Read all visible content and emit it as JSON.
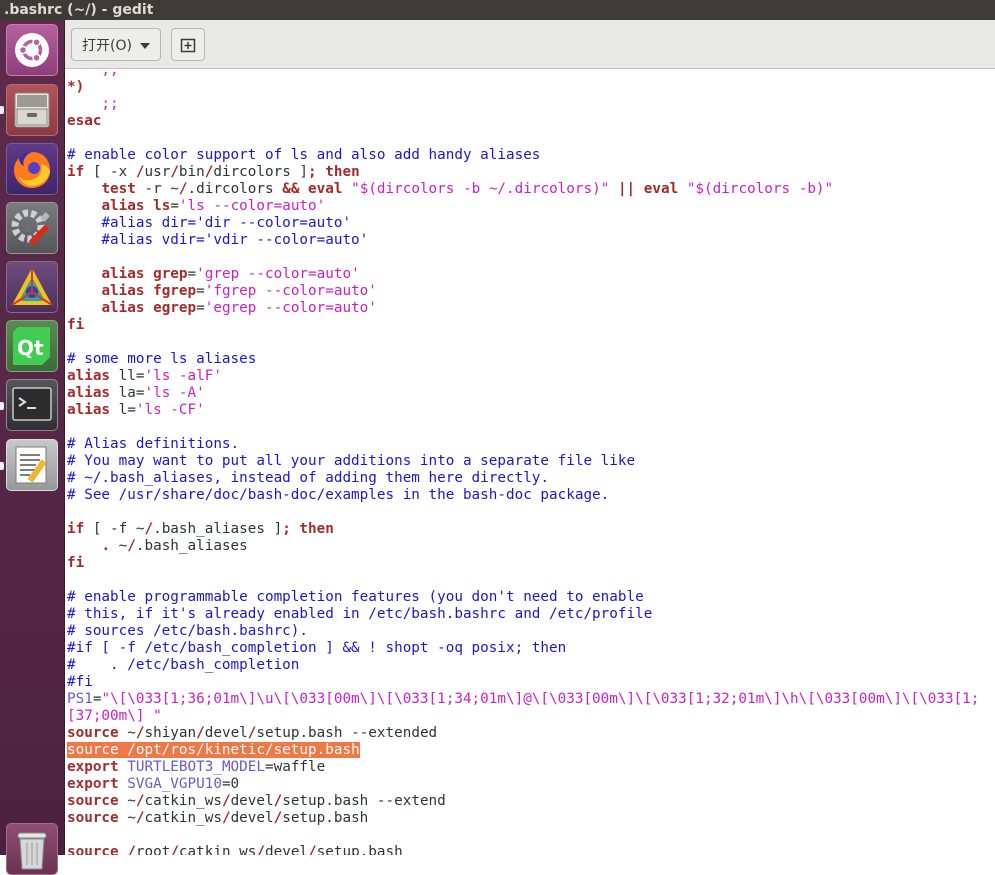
{
  "window": {
    "title": ".bashrc (~/) - gedit"
  },
  "toolbar": {
    "open_label": "打开(O)",
    "new_tab_icon": "new-tab-icon"
  },
  "launcher": [
    {
      "name": "ubuntu-dash-icon"
    },
    {
      "name": "files-icon"
    },
    {
      "name": "firefox-icon"
    },
    {
      "name": "system-settings-icon"
    },
    {
      "name": "rviz-icon"
    },
    {
      "name": "qt-creator-icon"
    },
    {
      "name": "terminal-icon"
    },
    {
      "name": "text-editor-icon"
    },
    {
      "name": "trash-icon"
    }
  ],
  "colors": {
    "keyword": "#a52a2a",
    "string": "#ce1ec4",
    "comment": "#1a17d4",
    "variable": "#6a5acd",
    "selection": "#f07746",
    "launcher": "#5d2a4c",
    "titlebar": "#3c3b37"
  },
  "code_lines": [
    [
      [
        "s",
        "    ;;"
      ]
    ],
    [
      [
        "k",
        "*)"
      ]
    ],
    [
      [
        "s",
        "    ;;"
      ]
    ],
    [
      [
        "k",
        "esac"
      ]
    ],
    [],
    [
      [
        "c",
        "# enable color support of ls and also add handy aliases"
      ]
    ],
    [
      [
        "k",
        "if"
      ],
      [
        "t",
        " [ -x "
      ],
      [
        "k",
        "/"
      ],
      [
        "t",
        "usr"
      ],
      [
        "k",
        "/"
      ],
      [
        "t",
        "bin"
      ],
      [
        "k",
        "/"
      ],
      [
        "t",
        "dircolors ]"
      ],
      [
        "k",
        "; then"
      ]
    ],
    [
      [
        "t",
        "    "
      ],
      [
        "k",
        "test"
      ],
      [
        "t",
        " -r ~"
      ],
      [
        "k",
        "/"
      ],
      [
        "t",
        ".dircolors "
      ],
      [
        "k",
        "&&"
      ],
      [
        "t",
        " "
      ],
      [
        "k",
        "eval"
      ],
      [
        "t",
        " "
      ],
      [
        "s",
        "\"$(dircolors -b ~/.dircolors)\""
      ],
      [
        "t",
        " "
      ],
      [
        "k",
        "||"
      ],
      [
        "t",
        " "
      ],
      [
        "k",
        "eval"
      ],
      [
        "t",
        " "
      ],
      [
        "s",
        "\"$(dircolors -b)\""
      ]
    ],
    [
      [
        "t",
        "    "
      ],
      [
        "k",
        "alias"
      ],
      [
        "t",
        " "
      ],
      [
        "k",
        "ls"
      ],
      [
        "t",
        "="
      ],
      [
        "s",
        "'ls --color=auto'"
      ]
    ],
    [
      [
        "c",
        "    #alias dir='dir --color=auto'"
      ]
    ],
    [
      [
        "c",
        "    #alias vdir='vdir --color=auto'"
      ]
    ],
    [],
    [
      [
        "t",
        "    "
      ],
      [
        "k",
        "alias"
      ],
      [
        "t",
        " "
      ],
      [
        "k",
        "grep"
      ],
      [
        "t",
        "="
      ],
      [
        "s",
        "'grep --color=auto'"
      ]
    ],
    [
      [
        "t",
        "    "
      ],
      [
        "k",
        "alias"
      ],
      [
        "t",
        " "
      ],
      [
        "k",
        "fgrep"
      ],
      [
        "t",
        "="
      ],
      [
        "s",
        "'fgrep --color=auto'"
      ]
    ],
    [
      [
        "t",
        "    "
      ],
      [
        "k",
        "alias"
      ],
      [
        "t",
        " "
      ],
      [
        "k",
        "egrep"
      ],
      [
        "t",
        "="
      ],
      [
        "s",
        "'egrep --color=auto'"
      ]
    ],
    [
      [
        "k",
        "fi"
      ]
    ],
    [],
    [
      [
        "c",
        "# some more ls aliases"
      ]
    ],
    [
      [
        "k",
        "alias"
      ],
      [
        "t",
        " ll="
      ],
      [
        "s",
        "'ls -alF'"
      ]
    ],
    [
      [
        "k",
        "alias"
      ],
      [
        "t",
        " la="
      ],
      [
        "s",
        "'ls -A'"
      ]
    ],
    [
      [
        "k",
        "alias"
      ],
      [
        "t",
        " l="
      ],
      [
        "s",
        "'ls -CF'"
      ]
    ],
    [],
    [
      [
        "c",
        "# Alias definitions."
      ]
    ],
    [
      [
        "c",
        "# You may want to put all your additions into a separate file like"
      ]
    ],
    [
      [
        "c",
        "# ~/.bash_aliases, instead of adding them here directly."
      ]
    ],
    [
      [
        "c",
        "# See /usr/share/doc/bash-doc/examples in the bash-doc package."
      ]
    ],
    [],
    [
      [
        "k",
        "if"
      ],
      [
        "t",
        " [ -f ~"
      ],
      [
        "k",
        "/"
      ],
      [
        "t",
        ".bash_aliases ]"
      ],
      [
        "k",
        "; then"
      ]
    ],
    [
      [
        "t",
        "    "
      ],
      [
        "k",
        "."
      ],
      [
        "t",
        " ~"
      ],
      [
        "k",
        "/"
      ],
      [
        "t",
        ".bash_aliases"
      ]
    ],
    [
      [
        "k",
        "fi"
      ]
    ],
    [],
    [
      [
        "c",
        "# enable programmable completion features (you don't need to enable"
      ]
    ],
    [
      [
        "c",
        "# this, if it's already enabled in /etc/bash.bashrc and /etc/profile"
      ]
    ],
    [
      [
        "c",
        "# sources /etc/bash.bashrc)."
      ]
    ],
    [
      [
        "c",
        "#if [ -f /etc/bash_completion ] && ! shopt -oq posix; then"
      ]
    ],
    [
      [
        "c",
        "#    . /etc/bash_completion"
      ]
    ],
    [
      [
        "c",
        "#fi"
      ]
    ],
    [
      [
        "v",
        "PS1"
      ],
      [
        "t",
        "="
      ],
      [
        "s",
        "\"\\[\\033[1;36;01m\\]\\u\\[\\033[00m\\]\\[\\033[1;34;01m\\]@\\[\\033[00m\\]\\[\\033[1;32;01m\\]\\h\\[\\033[00m\\]\\[\\033[1;"
      ]
    ],
    [
      [
        "s",
        "[37;00m\\] \""
      ]
    ],
    [
      [
        "k",
        "source"
      ],
      [
        "t",
        " ~"
      ],
      [
        "k",
        "/"
      ],
      [
        "t",
        "shiyan"
      ],
      [
        "k",
        "/"
      ],
      [
        "t",
        "devel"
      ],
      [
        "k",
        "/"
      ],
      [
        "t",
        "setup.bash --extended"
      ]
    ],
    [
      [
        "sel",
        "source /opt/ros/kinetic/setup.bash"
      ]
    ],
    [
      [
        "k",
        "export"
      ],
      [
        "t",
        " "
      ],
      [
        "v",
        "TURTLEBOT3_MODEL"
      ],
      [
        "t",
        "=waffle"
      ]
    ],
    [
      [
        "k",
        "export"
      ],
      [
        "t",
        " "
      ],
      [
        "v",
        "SVGA_VGPU10"
      ],
      [
        "t",
        "=0"
      ]
    ],
    [
      [
        "k",
        "source"
      ],
      [
        "t",
        " ~"
      ],
      [
        "k",
        "/"
      ],
      [
        "t",
        "catkin_ws"
      ],
      [
        "k",
        "/"
      ],
      [
        "t",
        "devel"
      ],
      [
        "k",
        "/"
      ],
      [
        "t",
        "setup.bash --extend"
      ]
    ],
    [
      [
        "k",
        "source"
      ],
      [
        "t",
        " ~"
      ],
      [
        "k",
        "/"
      ],
      [
        "t",
        "catkin_ws"
      ],
      [
        "k",
        "/"
      ],
      [
        "t",
        "devel"
      ],
      [
        "k",
        "/"
      ],
      [
        "t",
        "setup.bash"
      ]
    ],
    [],
    [
      [
        "k",
        "source"
      ],
      [
        "t",
        " "
      ],
      [
        "k",
        "/"
      ],
      [
        "t",
        "root"
      ],
      [
        "k",
        "/"
      ],
      [
        "t",
        "catkin_ws"
      ],
      [
        "k",
        "/"
      ],
      [
        "t",
        "devel"
      ],
      [
        "k",
        "/"
      ],
      [
        "t",
        "setup.bash"
      ]
    ]
  ]
}
